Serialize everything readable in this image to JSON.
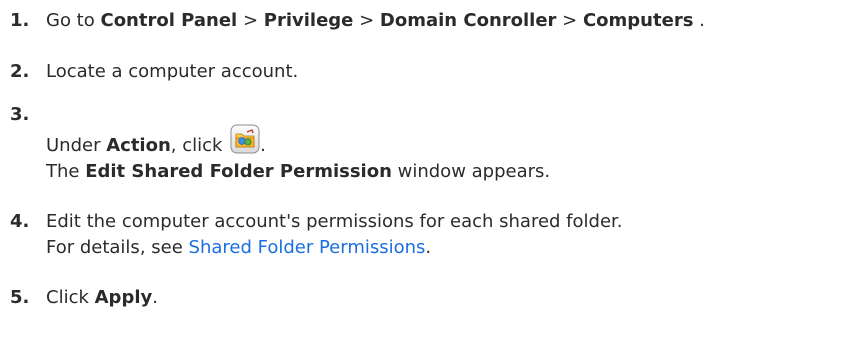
{
  "steps": [
    {
      "number": "1.",
      "text": {
        "go_to": "Go to ",
        "control_panel": "Control Panel",
        "sep1": " > ",
        "privilege": "Privilege",
        "sep2": " > ",
        "domain_controller": "Domain Conroller",
        "sep3": " > ",
        "computers": "Computers",
        "end": " ."
      }
    },
    {
      "number": "2.",
      "text": "Locate a computer account."
    },
    {
      "number": "3.",
      "text": {
        "under": "Under ",
        "action": "Action",
        "click": ", click ",
        "period": ".",
        "window_prefix": "The ",
        "window_name": "Edit Shared Folder Permission",
        "window_suffix": " window appears."
      },
      "icon": "edit-shared-folder-permission-icon"
    },
    {
      "number": "4.",
      "text": {
        "line1": "Edit the computer account's permissions for each shared folder.",
        "details_prefix": "For details, see ",
        "link": "Shared Folder Permissions",
        "details_suffix": "."
      }
    },
    {
      "number": "5.",
      "text": {
        "click": "Click ",
        "apply": "Apply",
        "end": "."
      }
    }
  ],
  "colors": {
    "text": "#2b2b2b",
    "link": "#1a6fe0"
  }
}
